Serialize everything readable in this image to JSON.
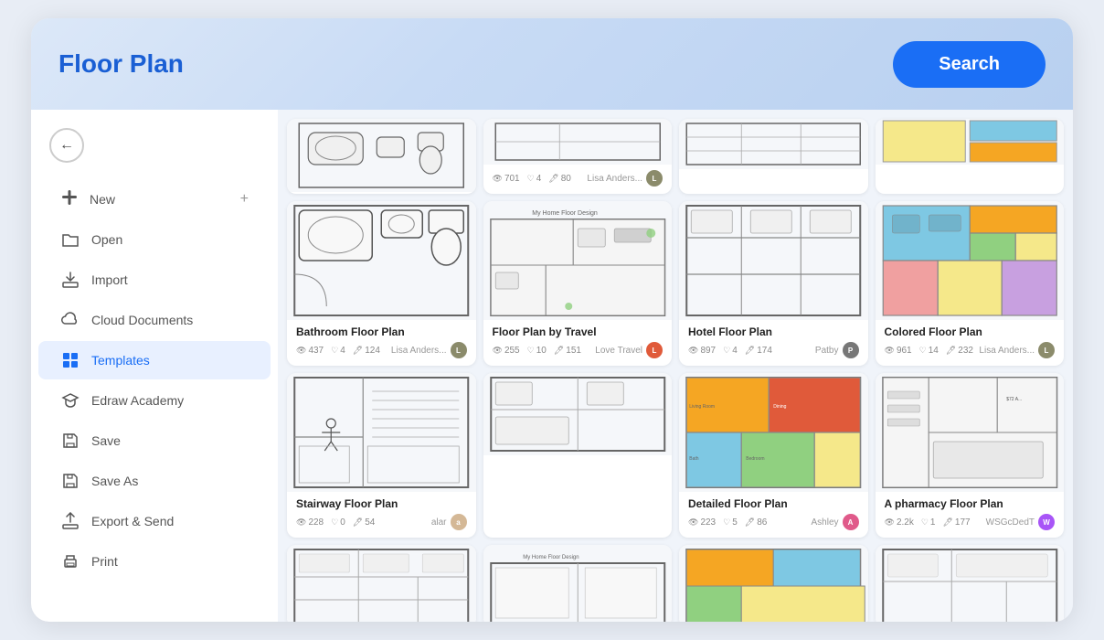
{
  "header": {
    "title": "Floor Plan",
    "search_label": "Search"
  },
  "sidebar": {
    "back_label": "←",
    "items": [
      {
        "id": "new",
        "label": "New",
        "icon": "➕",
        "extra": "➕",
        "active": false
      },
      {
        "id": "open",
        "label": "Open",
        "icon": "📁",
        "active": false
      },
      {
        "id": "import",
        "label": "Import",
        "icon": "📥",
        "active": false
      },
      {
        "id": "cloud",
        "label": "Cloud Documents",
        "icon": "☁️",
        "active": false
      },
      {
        "id": "templates",
        "label": "Templates",
        "icon": "🗂",
        "active": true
      },
      {
        "id": "academy",
        "label": "Edraw Academy",
        "icon": "🎓",
        "active": false
      },
      {
        "id": "save",
        "label": "Save",
        "icon": "💾",
        "active": false
      },
      {
        "id": "saveas",
        "label": "Save As",
        "icon": "💾",
        "active": false
      },
      {
        "id": "export",
        "label": "Export & Send",
        "icon": "📤",
        "active": false
      },
      {
        "id": "print",
        "label": "Print",
        "icon": "🖨",
        "active": false
      }
    ]
  },
  "cards": [
    {
      "id": "bathroom",
      "title": "Bathroom Floor Plan",
      "stats": {
        "views": "437",
        "likes": "4",
        "comments": "124"
      },
      "author": "Lisa Anders...",
      "avatar_color": "#8B8B6B",
      "position": "col1-row2"
    },
    {
      "id": "top1",
      "title": "",
      "stats": {
        "views": "701",
        "likes": "4",
        "comments": "80"
      },
      "author": "Lisa Anders...",
      "avatar_color": "#8B8B6B",
      "position": "col2-row1-partial"
    },
    {
      "id": "myhome",
      "title": "Floor Plan by Travel",
      "stats": {
        "views": "255",
        "likes": "10",
        "comments": "151"
      },
      "author": "Love Travel",
      "avatar_color": "#e05a3a",
      "position": "col2-row2"
    },
    {
      "id": "hotel",
      "title": "Hotel Floor Plan",
      "stats": {
        "views": "897",
        "likes": "4",
        "comments": "174"
      },
      "author": "Patby",
      "avatar_color": "#666",
      "position": "col3-row1"
    },
    {
      "id": "detailed",
      "title": "Detailed Floor Plan",
      "stats": {
        "views": "223",
        "likes": "5",
        "comments": "86"
      },
      "author": "Ashley",
      "avatar_color": "#e05a8a",
      "position": "col3-row2"
    },
    {
      "id": "colored",
      "title": "Colored Floor Plan",
      "stats": {
        "views": "961",
        "likes": "14",
        "comments": "232"
      },
      "author": "Lisa Anders...",
      "avatar_color": "#8B8B6B",
      "position": "col4-row1"
    },
    {
      "id": "pharmacy",
      "title": "A pharmacy Floor Plan",
      "stats": {
        "views": "2.2k",
        "likes": "1",
        "comments": "177"
      },
      "author": "WSGcDedT",
      "avatar_color": "#a855f7",
      "position": "col4-row2"
    },
    {
      "id": "stairway",
      "title": "Stairway Floor Plan",
      "stats": {
        "views": "228",
        "likes": "0",
        "comments": "54"
      },
      "author": "alar",
      "avatar_color": "#d4b896",
      "position": "col1-row3"
    },
    {
      "id": "bottom2",
      "title": "",
      "stats": {
        "views": "",
        "likes": "",
        "comments": ""
      },
      "author": "",
      "avatar_color": "#666",
      "position": "col2-row3-partial"
    },
    {
      "id": "myhome2",
      "title": "",
      "stats": {
        "views": "",
        "likes": "",
        "comments": ""
      },
      "author": "",
      "avatar_color": "#666",
      "position": "col3-row3-partial"
    },
    {
      "id": "bottom4",
      "title": "",
      "stats": {
        "views": "",
        "likes": "",
        "comments": ""
      },
      "author": "",
      "avatar_color": "#666",
      "position": "col4-row3-partial"
    }
  ],
  "icons": {
    "views": "👁",
    "likes": "♡",
    "comments": "💬",
    "back": "←"
  }
}
